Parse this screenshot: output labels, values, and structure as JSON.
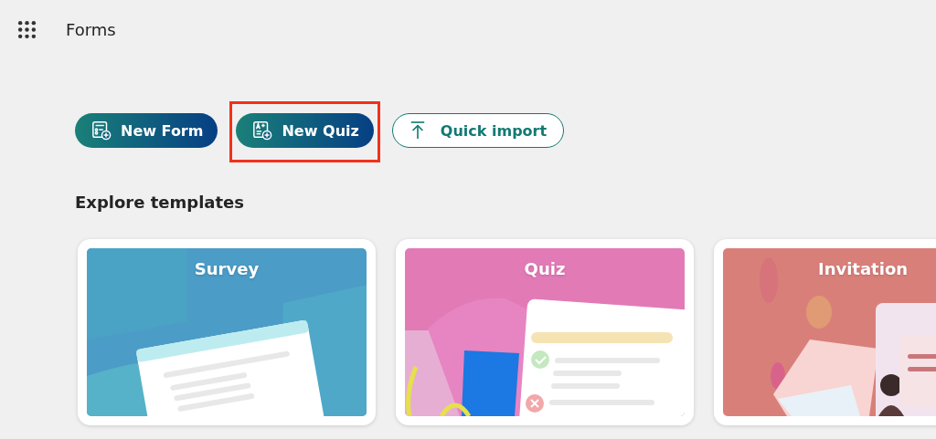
{
  "header": {
    "app_name": "Forms"
  },
  "actions": [
    {
      "kind": "form",
      "label": "New Form",
      "highlighted": false
    },
    {
      "kind": "quiz",
      "label": "New Quiz",
      "highlighted": true
    },
    {
      "kind": "import",
      "label": "Quick import",
      "highlighted": false
    }
  ],
  "templates": {
    "heading": "Explore templates",
    "cards": [
      {
        "kind": "survey",
        "title": "Survey"
      },
      {
        "kind": "quiz",
        "title": "Quiz"
      },
      {
        "kind": "invitation",
        "title": "Invitation"
      }
    ]
  }
}
